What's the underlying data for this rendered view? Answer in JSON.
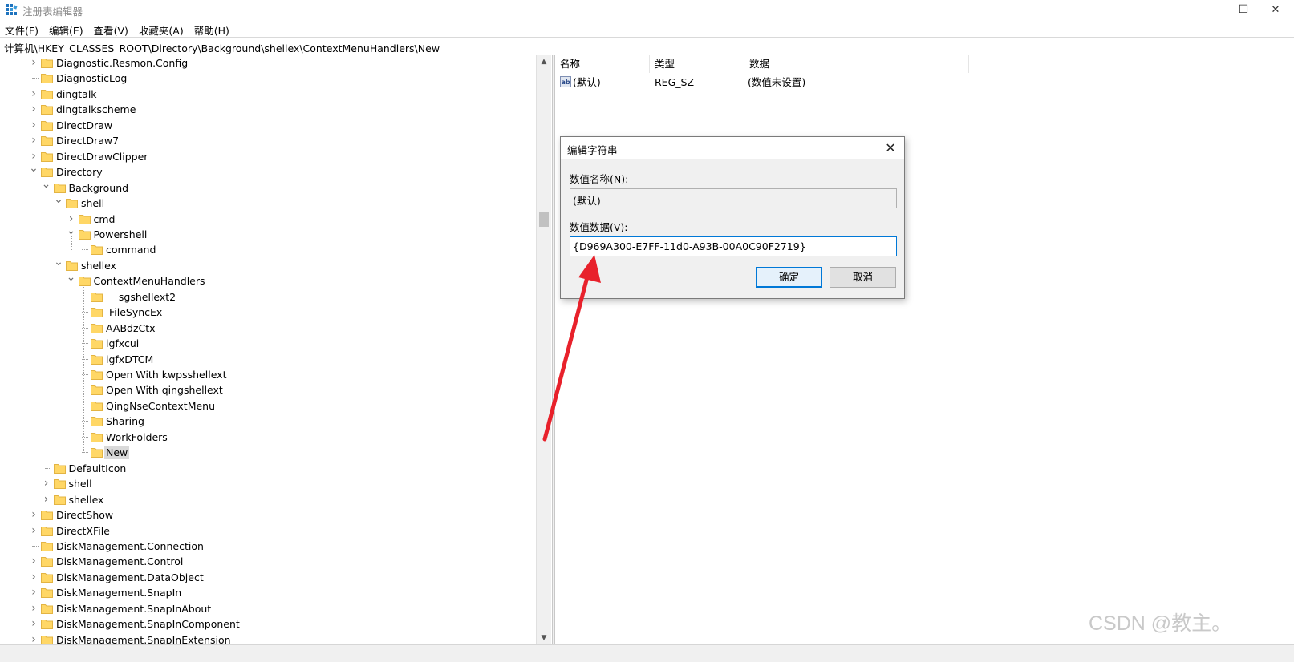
{
  "window": {
    "title": "注册表编辑器",
    "minimize_glyph": "—",
    "maximize_glyph": "☐",
    "close_glyph": "✕"
  },
  "menu": [
    "文件(F)",
    "编辑(E)",
    "查看(V)",
    "收藏夹(A)",
    "帮助(H)"
  ],
  "address": "计算机\\HKEY_CLASSES_ROOT\\Directory\\Background\\shellex\\ContextMenuHandlers\\New",
  "tree": [
    {
      "label": "Diagnostic.Resmon.Config",
      "level": 0,
      "state": "collapsed"
    },
    {
      "label": "DiagnosticLog",
      "level": 0,
      "state": "leaf"
    },
    {
      "label": "dingtalk",
      "level": 0,
      "state": "collapsed"
    },
    {
      "label": "dingtalkscheme",
      "level": 0,
      "state": "collapsed"
    },
    {
      "label": "DirectDraw",
      "level": 0,
      "state": "collapsed"
    },
    {
      "label": "DirectDraw7",
      "level": 0,
      "state": "collapsed"
    },
    {
      "label": "DirectDrawClipper",
      "level": 0,
      "state": "collapsed"
    },
    {
      "label": "Directory",
      "level": 0,
      "state": "expanded"
    },
    {
      "label": "Background",
      "level": 1,
      "state": "expanded"
    },
    {
      "label": "shell",
      "level": 2,
      "state": "expanded"
    },
    {
      "label": "cmd",
      "level": 3,
      "state": "collapsed"
    },
    {
      "label": "Powershell",
      "level": 3,
      "state": "expanded"
    },
    {
      "label": "command",
      "level": 4,
      "state": "leaf"
    },
    {
      "label": "shellex",
      "level": 2,
      "state": "expanded"
    },
    {
      "label": "ContextMenuHandlers",
      "level": 3,
      "state": "expanded"
    },
    {
      "label": "    sgshellext2",
      "level": 4,
      "state": "leaf"
    },
    {
      "label": " FileSyncEx",
      "level": 4,
      "state": "leaf"
    },
    {
      "label": "AABdzCtx",
      "level": 4,
      "state": "leaf"
    },
    {
      "label": "igfxcui",
      "level": 4,
      "state": "leaf"
    },
    {
      "label": "igfxDTCM",
      "level": 4,
      "state": "leaf"
    },
    {
      "label": "Open With kwpsshellext",
      "level": 4,
      "state": "leaf"
    },
    {
      "label": "Open With qingshellext",
      "level": 4,
      "state": "leaf"
    },
    {
      "label": "QingNseContextMenu",
      "level": 4,
      "state": "leaf"
    },
    {
      "label": "Sharing",
      "level": 4,
      "state": "leaf"
    },
    {
      "label": "WorkFolders",
      "level": 4,
      "state": "leaf"
    },
    {
      "label": "New",
      "level": 4,
      "state": "leaf",
      "selected": true
    },
    {
      "label": "DefaultIcon",
      "level": 1,
      "state": "leaf"
    },
    {
      "label": "shell",
      "level": 1,
      "state": "collapsed"
    },
    {
      "label": "shellex",
      "level": 1,
      "state": "collapsed"
    },
    {
      "label": "DirectShow",
      "level": 0,
      "state": "collapsed"
    },
    {
      "label": "DirectXFile",
      "level": 0,
      "state": "collapsed"
    },
    {
      "label": "DiskManagement.Connection",
      "level": 0,
      "state": "leaf"
    },
    {
      "label": "DiskManagement.Control",
      "level": 0,
      "state": "collapsed"
    },
    {
      "label": "DiskManagement.DataObject",
      "level": 0,
      "state": "collapsed"
    },
    {
      "label": "DiskManagement.SnapIn",
      "level": 0,
      "state": "collapsed"
    },
    {
      "label": "DiskManagement.SnapInAbout",
      "level": 0,
      "state": "collapsed"
    },
    {
      "label": "DiskManagement.SnapInComponent",
      "level": 0,
      "state": "collapsed"
    },
    {
      "label": "DiskManagement.SnapInExtension",
      "level": 0,
      "state": "collapsed"
    }
  ],
  "list": {
    "headers": {
      "name": "名称",
      "type": "类型",
      "data": "数据"
    },
    "rows": [
      {
        "icon": "string-value-icon",
        "icon_text": "ab",
        "name": "(默认)",
        "type": "REG_SZ",
        "data": "(数值未设置)"
      }
    ]
  },
  "dialog": {
    "title": "编辑字符串",
    "name_label": "数值名称(N):",
    "name_value": "(默认)",
    "data_label": "数值数据(V):",
    "data_value": "{D969A300-E7FF-11d0-A93B-00A0C90F2719}",
    "ok": "确定",
    "cancel": "取消"
  },
  "annotation": {
    "arrow_color": "#e8212b"
  },
  "watermark": "CSDN @教主。",
  "colors": {
    "folder": "#ffd766",
    "folder_edge": "#e3b443",
    "selection": "#d9d9d9",
    "focus": "#0078d7"
  }
}
